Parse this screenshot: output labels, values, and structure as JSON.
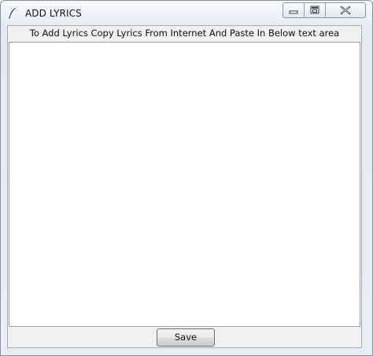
{
  "window": {
    "title": "ADD LYRICS",
    "icon": "feather-icon"
  },
  "controls": {
    "minimize_icon": "minimize-icon",
    "maximize_icon": "maximize-icon",
    "close_icon": "close-icon"
  },
  "main": {
    "instruction": "To Add Lyrics Copy Lyrics From Internet And Paste In Below text area",
    "lyrics_text": ""
  },
  "footer": {
    "save_label": "Save"
  }
}
